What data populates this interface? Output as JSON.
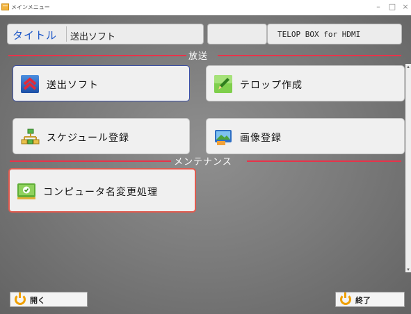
{
  "window": {
    "title": "メインメニュー",
    "controls": {
      "minimize": "–",
      "maximize": "□",
      "close": "×"
    }
  },
  "header": {
    "title_label": "タイトル",
    "title_value": "送出ソフト",
    "product": "TELOP BOX for HDMI"
  },
  "sections": [
    {
      "label": "放送",
      "items": [
        {
          "label": "送出ソフト",
          "icon": "double-chevron-up-icon"
        },
        {
          "label": "テロップ作成",
          "icon": "green-pen-icon"
        },
        {
          "label": "スケジュール登録",
          "icon": "schedule-network-icon"
        },
        {
          "label": "画像登録",
          "icon": "image-register-icon"
        }
      ]
    },
    {
      "label": "メンテナンス",
      "items": [
        {
          "label": "コンピュータ名変更処理",
          "icon": "computer-rename-icon"
        }
      ]
    }
  ],
  "bottom": {
    "open_label": "開く",
    "exit_label": "終了"
  },
  "colors": {
    "accent_red": "#e8334a",
    "title_blue": "#1a55c7",
    "power_orange": "#f0a000"
  }
}
